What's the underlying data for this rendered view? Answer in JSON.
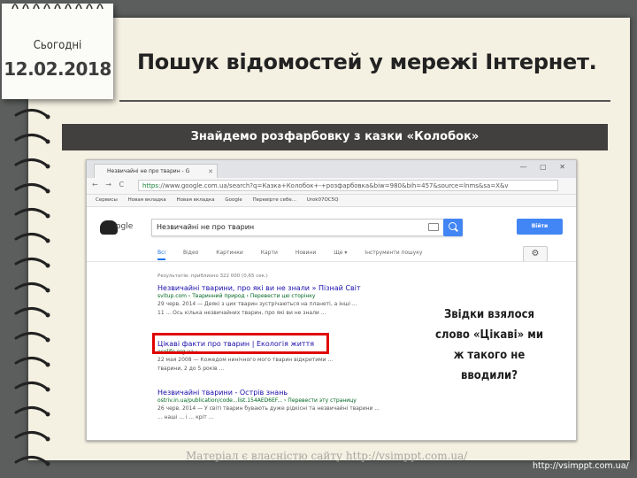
{
  "slide": {
    "note_label": "Сьогодні",
    "date": "12.02.2018",
    "title": "Пошук відомостей у мережі Інтернет.",
    "banner": "Знайдемо розфарбовку з казки «Колобок»",
    "callout_lines": [
      "Звідки взялося",
      "слово «Цікаві» ми",
      "ж такого не",
      "вводили?"
    ],
    "footer": "Матеріал є власністю сайту http://vsimppt.com.ua/",
    "corner_url": "http://vsimppt.com.ua/"
  },
  "browser": {
    "tab_title": "Незвичайні не про тварин - G",
    "window_controls": "— ▢ ✕",
    "nav": "← → C",
    "url_scheme": "https",
    "url_rest": "://www.google.com.ua/search?q=Казка+Колобок+-+розфарбовка&biw=980&bih=457&source=lnms&sa=X&v",
    "bookmarks": [
      "Сервисы",
      "Новая вкладка",
      "Новая вкладка",
      "Google",
      "Перевірте себе...",
      "Urok07OC5Q"
    ],
    "search_query": "Незвичайні не про тварин",
    "signin_label": "Війти",
    "gtabs": [
      "Всі",
      "Відео",
      "Картинки",
      "Карти",
      "Новини",
      "Ще ▾",
      "Інструменти пошуку"
    ],
    "gear": "⚙",
    "results_count": "Результатів: приблизно 322 000 (0,65 сек.)",
    "results": [
      {
        "title": "Незвичайні тварини, про які ви не знали » Пізнай Світ",
        "url": "svitup.com › Тваринний природ › Перевести цю сторінку",
        "snippet": [
          "29 черв. 2014 — Деякі з цих тварин зустрічаються на планеті, а інші ...",
          "11 ... Ось кілька незвичайних тварин, про які ви не знали ..."
        ]
      },
      {
        "title": "Цікаві факти про тварин | Екологія життя",
        "url": "ecolife.org.ua › ...",
        "snippet": [
          "22 мая 2008 — Кожедом нинічного мого тварин відкритими ...",
          "тварини, 2 до 5 років ..."
        ]
      },
      {
        "title": "Незвичайні тварини - Острів знань",
        "url": "ostriv.in.ua/publication/code...list.154AED6EF... › Перевести эту страницу",
        "snippet": [
          "26 черв. 2014 — У світі тварин бувають дуже рідкісні та незвичайні тварини ...",
          "... наші ... і ... кріт ..."
        ]
      }
    ]
  }
}
